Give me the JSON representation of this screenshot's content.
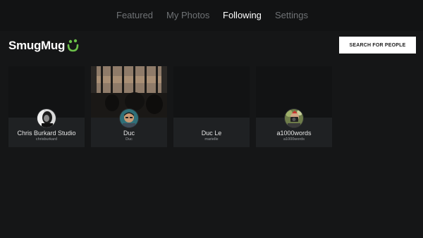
{
  "nav": {
    "tabs": [
      {
        "label": "Featured"
      },
      {
        "label": "My Photos"
      },
      {
        "label": "Following"
      },
      {
        "label": "Settings"
      }
    ],
    "active_tab": "Following"
  },
  "header": {
    "logo_text": "SmugMug",
    "logo_icon": "smile-icon",
    "search_button_label": "SEARCH FOR PEOPLE"
  },
  "following": [
    {
      "name": "Chris Burkard Studio",
      "username": "chrisburkard",
      "avatar_icon": "avatar-bw-portrait",
      "has_cover_photo": false
    },
    {
      "name": "Duc",
      "username": "Duc",
      "avatar_icon": "avatar-portrait",
      "has_cover_photo": true
    },
    {
      "name": "Duc Le",
      "username": "marielle",
      "avatar_icon": null,
      "has_cover_photo": false
    },
    {
      "name": "a1000words",
      "username": "a1000words",
      "avatar_icon": "avatar-camera-portrait",
      "has_cover_photo": false
    }
  ],
  "colors": {
    "background": "#151617",
    "card": "#1f2123",
    "brand_green": "#6cc04a",
    "tab_inactive": "#6f7275",
    "tab_active": "#ffffff"
  }
}
